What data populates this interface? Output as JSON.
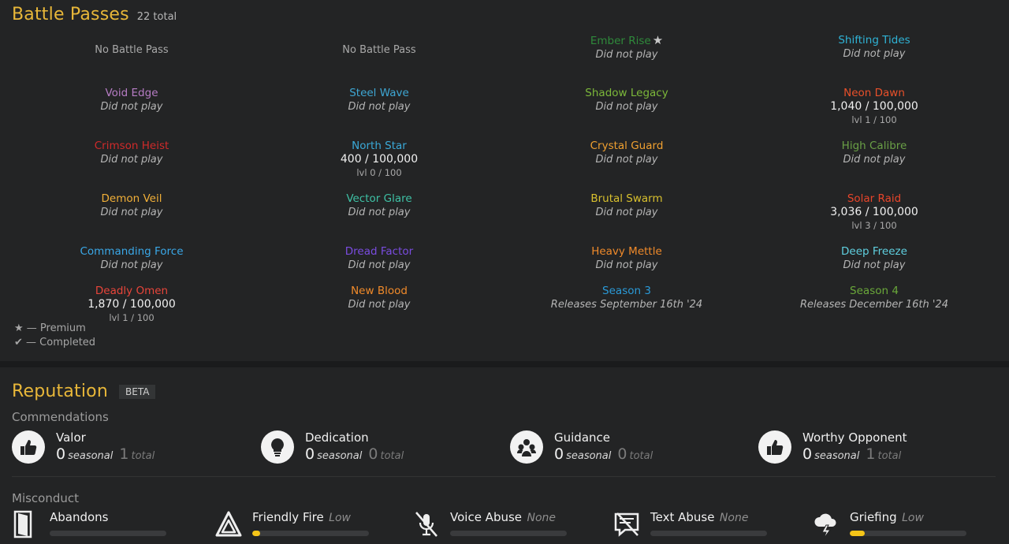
{
  "battle_passes": {
    "title": "Battle Passes",
    "count": "22 total",
    "items": [
      {
        "name": "No Battle Pass",
        "none": true
      },
      {
        "name": "No Battle Pass",
        "none": true
      },
      {
        "name": "Ember Rise",
        "color": "#2f8a3b",
        "premium": true,
        "status": "Did not play"
      },
      {
        "name": "Shifting Tides",
        "color": "#2fb3d6",
        "status": "Did not play"
      },
      {
        "name": "Void Edge",
        "color": "#b67cc4",
        "status": "Did not play"
      },
      {
        "name": "Steel Wave",
        "color": "#3ea7d4",
        "status": "Did not play"
      },
      {
        "name": "Shadow Legacy",
        "color": "#7cb83a",
        "status": "Did not play"
      },
      {
        "name": "Neon Dawn",
        "color": "#e8502a",
        "xp": "1,040 / 100,000",
        "level": "lvl 1 / 100"
      },
      {
        "name": "Crimson Heist",
        "color": "#d02a2a",
        "status": "Did not play"
      },
      {
        "name": "North Star",
        "color": "#3aa9d8",
        "xp": "400 / 100,000",
        "level": "lvl 0 / 100"
      },
      {
        "name": "Crystal Guard",
        "color": "#f0a030",
        "status": "Did not play"
      },
      {
        "name": "High Calibre",
        "color": "#6aa046",
        "status": "Did not play"
      },
      {
        "name": "Demon Veil",
        "color": "#f2b038",
        "status": "Did not play"
      },
      {
        "name": "Vector Glare",
        "color": "#3ec1a5",
        "status": "Did not play"
      },
      {
        "name": "Brutal Swarm",
        "color": "#d8c02e",
        "status": "Did not play"
      },
      {
        "name": "Solar Raid",
        "color": "#e8452a",
        "xp": "3,036 / 100,000",
        "level": "lvl 3 / 100"
      },
      {
        "name": "Commanding Force",
        "color": "#3aa8e8",
        "status": "Did not play"
      },
      {
        "name": "Dread Factor",
        "color": "#7a4ce0",
        "status": "Did not play"
      },
      {
        "name": "Heavy Mettle",
        "color": "#f08a2a",
        "status": "Did not play"
      },
      {
        "name": "Deep Freeze",
        "color": "#5fd0e0",
        "status": "Did not play"
      },
      {
        "name": "Deadly Omen",
        "color": "#e8453a",
        "xp": "1,870 / 100,000",
        "level": "lvl 1 / 100"
      },
      {
        "name": "New Blood",
        "color": "#f08a2a",
        "status": "Did not play"
      },
      {
        "name": "Season 3",
        "color": "#2a9ad8",
        "status": "Releases September 16th '24"
      },
      {
        "name": "Season 4",
        "color": "#6aa83a",
        "status": "Releases December 16th '24"
      }
    ],
    "legend": {
      "premium": "★ — Premium",
      "completed": "✔ — Completed"
    }
  },
  "reputation": {
    "title": "Reputation",
    "badge": "BETA",
    "commendations_label": "Commendations",
    "misconduct_label": "Misconduct",
    "seasonal_unit": "seasonal",
    "total_unit": "total",
    "commendations": [
      {
        "name": "Valor",
        "seasonal": "0",
        "total": "1",
        "icon": "thumbs-up-icon"
      },
      {
        "name": "Dedication",
        "seasonal": "0",
        "total": "0",
        "icon": "lightbulb-icon"
      },
      {
        "name": "Guidance",
        "seasonal": "0",
        "total": "0",
        "icon": "team-icon"
      },
      {
        "name": "Worthy Opponent",
        "seasonal": "0",
        "total": "1",
        "icon": "thumbs-up-icon"
      }
    ],
    "misconduct": [
      {
        "name": "Abandons",
        "level": "",
        "fill": 0,
        "icon": "door-exit-icon"
      },
      {
        "name": "Friendly Fire",
        "level": "Low",
        "fill": 0.06,
        "icon": "triangle-warning-icon"
      },
      {
        "name": "Voice Abuse",
        "level": "None",
        "fill": 0,
        "icon": "muted-mic-icon"
      },
      {
        "name": "Text Abuse",
        "level": "None",
        "fill": 0,
        "icon": "text-blocked-icon"
      },
      {
        "name": "Griefing",
        "level": "Low",
        "fill": 0.13,
        "icon": "storm-cloud-icon"
      }
    ],
    "accent_color": "#f5c518"
  }
}
